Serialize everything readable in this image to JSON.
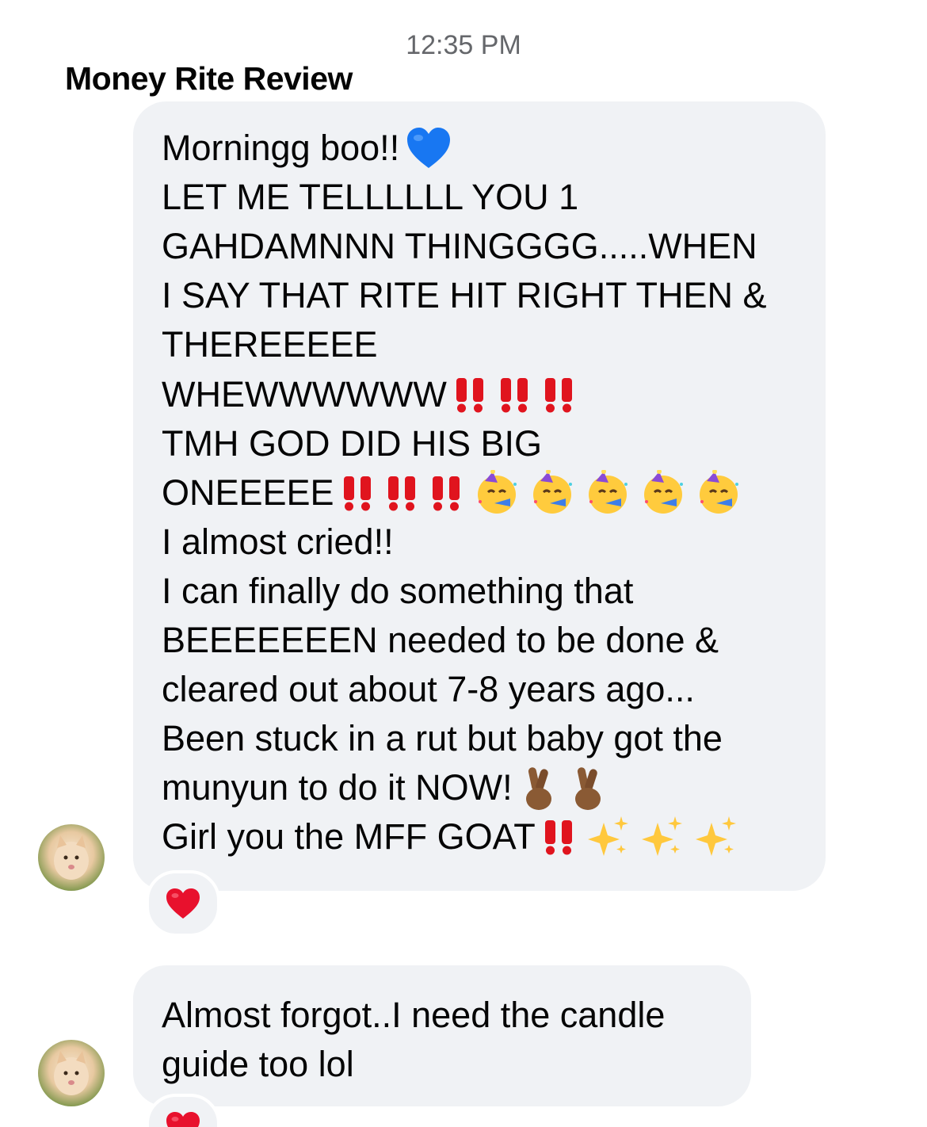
{
  "conversation": {
    "timestamp": "12:35 PM",
    "sender_name": "Money Rite Review"
  },
  "messages": [
    {
      "lines": [
        "Morningg boo!!",
        "LET ME TELLLLLL YOU 1",
        "GAHDAMNNN THINGGGG.....WHEN",
        "I SAY THAT RITE HIT RIGHT THEN &",
        "THEREEEEE",
        "WHEWWWWWW",
        "TMH GOD DID HIS BIG",
        "ONEEEEE",
        "I almost cried!!",
        "I can finally do something that",
        "BEEEEEEEN needed to be done &",
        "cleared out about 7-8 years ago...",
        "Been stuck in a rut but baby got the",
        "munyun to do it NOW!",
        "Girl you the MFF GOAT"
      ],
      "inline_emoji": {
        "line_0": [
          "blue-heart"
        ],
        "line_5": [
          "double-exclamation",
          "double-exclamation",
          "double-exclamation"
        ],
        "line_7": [
          "double-exclamation",
          "double-exclamation",
          "double-exclamation",
          "partying-face",
          "partying-face",
          "partying-face",
          "partying-face",
          "partying-face"
        ],
        "line_13": [
          "crossed-fingers",
          "crossed-fingers"
        ],
        "line_14": [
          "double-exclamation",
          "sparkles",
          "sparkles",
          "sparkles"
        ]
      },
      "reaction": "red-heart"
    },
    {
      "lines": [
        "Almost forgot..I need the candle",
        "guide too lol"
      ],
      "reaction": "red-heart"
    }
  ],
  "colors": {
    "bubble_bg": "#f0f2f5",
    "timestamp": "#65676b",
    "text": "#050505",
    "exclamation_red": "#e0141e",
    "heart_blue": "#1877f2",
    "heart_red": "#e8112d"
  }
}
